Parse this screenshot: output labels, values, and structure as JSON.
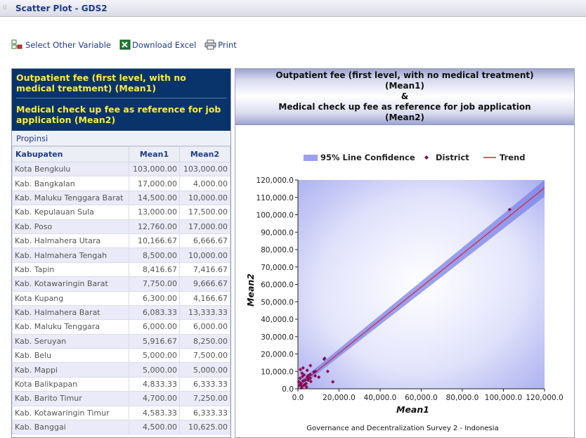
{
  "window": {
    "title": "Scatter Plot - GDS2"
  },
  "toolbar": {
    "select_label": "Select Other Variable",
    "download_label": "Download Excel",
    "print_label": "Print"
  },
  "panel": {
    "var1": "Outpatient fee (first level, with no medical treatment) (Mean1)",
    "var2": "Medical check up fee as reference for job application (Mean2)",
    "group_label": "Propinsi"
  },
  "table": {
    "headers": [
      "Kabupaten",
      "Mean1",
      "Mean2"
    ],
    "rows": [
      [
        "Kota Bengkulu",
        "103,000.00",
        "103,000.00"
      ],
      [
        "Kab. Bangkalan",
        "17,000.00",
        "4,000.00"
      ],
      [
        "Kab. Maluku Tenggara Barat",
        "14,500.00",
        "10,000.00"
      ],
      [
        "Kab. Kepulauan Sula",
        "13,000.00",
        "17,500.00"
      ],
      [
        "Kab. Poso",
        "12,760.00",
        "17,000.00"
      ],
      [
        "Kab. Halmahera Utara",
        "10,166.67",
        "6,666.67"
      ],
      [
        "Kab. Halmahera Tengah",
        "8,500.00",
        "10,000.00"
      ],
      [
        "Kab. Tapin",
        "8,416.67",
        "7,416.67"
      ],
      [
        "Kab. Kotawaringin Barat",
        "7,750.00",
        "9,666.67"
      ],
      [
        "Kota Kupang",
        "6,300.00",
        "4,166.67"
      ],
      [
        "Kab. Halmahera Barat",
        "6,083.33",
        "13,333.33"
      ],
      [
        "Kab. Maluku Tenggara",
        "6,000.00",
        "6,000.00"
      ],
      [
        "Kab. Seruyan",
        "5,916.67",
        "8,250.00"
      ],
      [
        "Kab. Belu",
        "5,000.00",
        "7,500.00"
      ],
      [
        "Kab. Mappi",
        "5,000.00",
        "5,000.00"
      ],
      [
        "Kota Balikpapan",
        "4,833.33",
        "6,333.33"
      ],
      [
        "Kab. Barito Timur",
        "4,700.00",
        "7,250.00"
      ],
      [
        "Kab. Kotawaringin Timur",
        "4,583.33",
        "6,333.33"
      ],
      [
        "Kab. Banggai",
        "4,500.00",
        "10,625.00"
      ]
    ]
  },
  "chart_title_lines": [
    "Outpatient fee (first level, with no medical treatment)",
    "(Mean1)",
    "&",
    "Medical check up fee as reference for job application",
    "(Mean2)"
  ],
  "chart_data": {
    "type": "scatter",
    "title": "Outpatient fee (first level, with no medical treatment) (Mean1) & Medical check up fee as reference for job application (Mean2)",
    "xlabel": "Mean1",
    "ylabel": "Mean2",
    "footer": "Governance and Decentralization Survey 2 - Indonesia",
    "xlim": [
      0,
      120000
    ],
    "ylim": [
      0,
      120000
    ],
    "xticks": [
      "0.0",
      "20,000.0",
      "40,000.0",
      "60,000.0",
      "80,000.0",
      "100,000.0",
      "120,000.0"
    ],
    "yticks": [
      "0.0",
      "10,000.0",
      "20,000.0",
      "30,000.0",
      "40,000.0",
      "50,000.0",
      "60,000.0",
      "70,000.0",
      "80,000.0",
      "90,000.0",
      "100,000.0",
      "110,000.0",
      "120,000.0"
    ],
    "legend": [
      "95% Line Confidence",
      "District",
      "Trend"
    ],
    "legend_position": "top",
    "colors": {
      "points": "#8b0a50",
      "trend": "#d9232e",
      "confidence": "#7a82e8"
    },
    "trend": {
      "x": [
        0,
        120000
      ],
      "y": [
        1500,
        115500
      ]
    },
    "confidence_band": {
      "x": [
        0,
        120000
      ],
      "lower": [
        -500,
        110500
      ],
      "upper": [
        3500,
        120000
      ]
    },
    "points": [
      [
        103000,
        103000
      ],
      [
        17000,
        4000
      ],
      [
        14500,
        10000
      ],
      [
        13000,
        17500
      ],
      [
        12760,
        17000
      ],
      [
        10166.67,
        6666.67
      ],
      [
        8500,
        10000
      ],
      [
        8416.67,
        7416.67
      ],
      [
        7750,
        9666.67
      ],
      [
        6300,
        4166.67
      ],
      [
        6083.33,
        13333.33
      ],
      [
        6000,
        6000
      ],
      [
        5916.67,
        8250
      ],
      [
        5000,
        7500
      ],
      [
        5000,
        5000
      ],
      [
        4833.33,
        6333.33
      ],
      [
        4700,
        7250
      ],
      [
        4583.33,
        6333.33
      ],
      [
        4500,
        10625
      ],
      [
        4000,
        3000
      ],
      [
        3500,
        5000
      ],
      [
        3000,
        2000
      ],
      [
        2500,
        4500
      ],
      [
        2000,
        1500
      ],
      [
        1500,
        3000
      ],
      [
        1000,
        6000
      ],
      [
        3000,
        8000
      ],
      [
        2000,
        9000
      ],
      [
        1200,
        11000
      ],
      [
        2500,
        12000
      ],
      [
        3500,
        2500
      ],
      [
        1800,
        500
      ],
      [
        800,
        2000
      ],
      [
        4200,
        1000
      ],
      [
        2200,
        7000
      ],
      [
        500,
        4000
      ]
    ]
  }
}
